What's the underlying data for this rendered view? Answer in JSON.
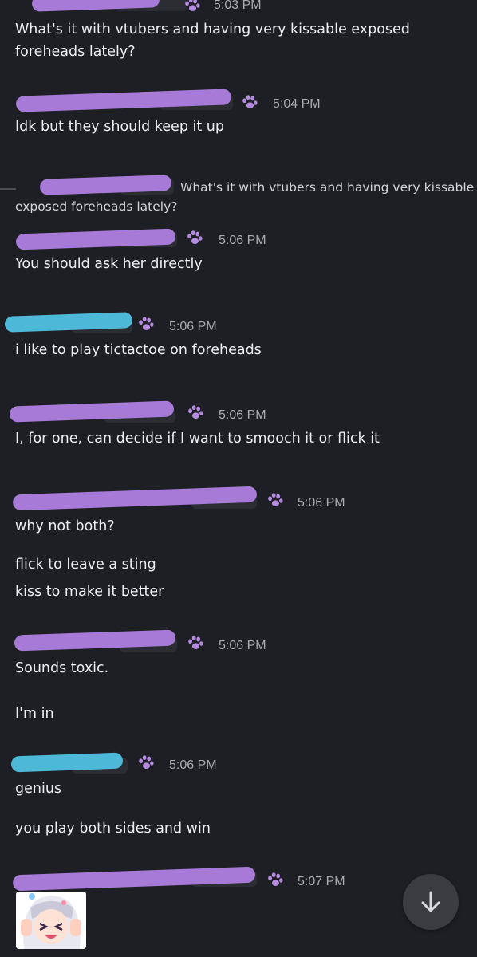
{
  "messages": [
    {
      "time": "5:03 PM",
      "lines": [
        "What's it with vtubers and having very kissable exposed",
        "foreheads lately?"
      ]
    },
    {
      "time": "5:04 PM",
      "lines": [
        "Idk but they should keep it up"
      ]
    },
    {
      "reply_preview": [
        "What's it with vtubers and having very kissable",
        "exposed foreheads lately?"
      ],
      "time": "5:06 PM",
      "lines": [
        "You should ask her directly"
      ]
    },
    {
      "time": "5:06 PM",
      "lines": [
        "i like to play tictactoe on foreheads"
      ]
    },
    {
      "time": "5:06 PM",
      "lines": [
        "I, for one, can decide if I want to smooch it or flick it"
      ]
    },
    {
      "time": "5:06 PM",
      "lines": [
        "why not both?",
        "flick to leave a sting",
        "kiss to make it better"
      ]
    },
    {
      "time": "5:06 PM",
      "lines": [
        "Sounds toxic.",
        "I'm in"
      ]
    },
    {
      "time": "5:06 PM",
      "lines": [
        "genius",
        "you play both sides and win"
      ]
    },
    {
      "time": "5:07 PM",
      "sticker": "anime-girl-sticker"
    }
  ],
  "icons": {
    "paw": "paw-icon",
    "scroll": "arrow-down-icon"
  },
  "colors": {
    "background": "#1e1f24",
    "paw": "#b58be0",
    "redaction_purple": "#a67ad6",
    "redaction_cyan": "#4eb8d8"
  }
}
